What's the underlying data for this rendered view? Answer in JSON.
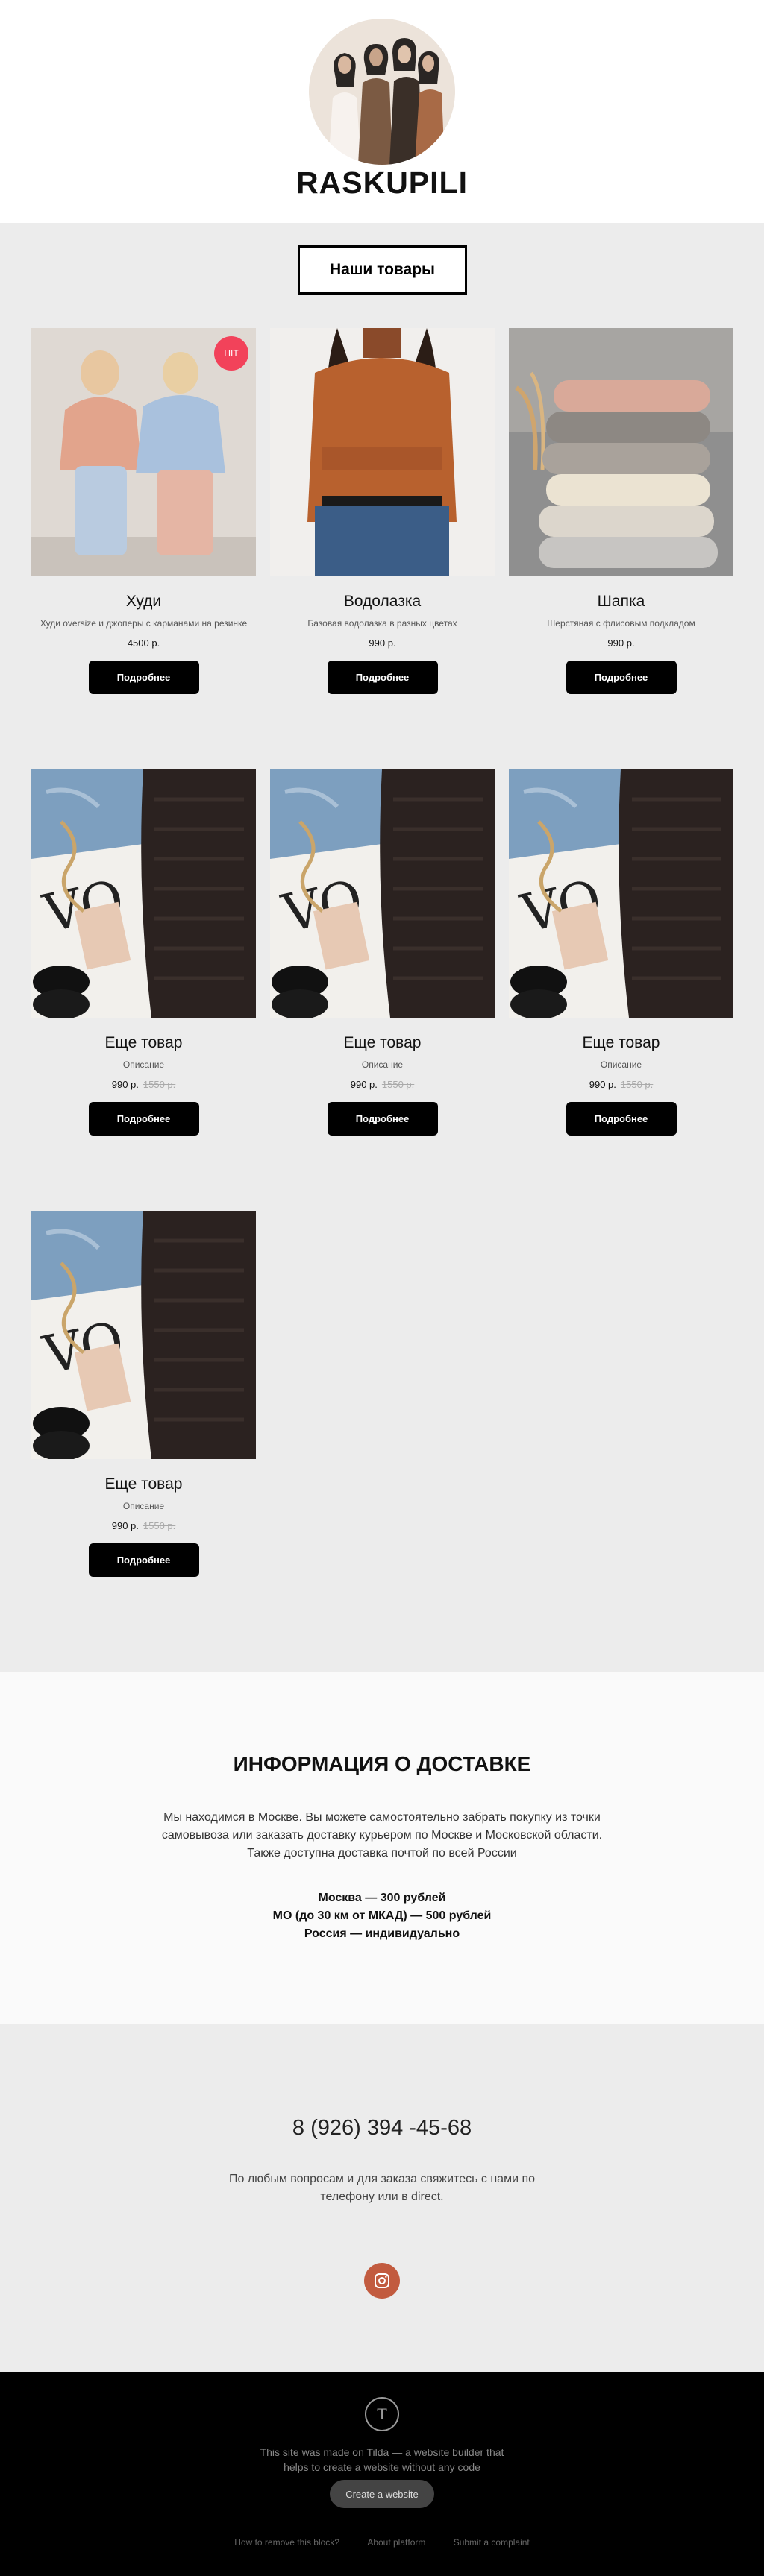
{
  "header": {
    "brand": "RASKUPILI"
  },
  "products_section": {
    "heading_button": "Наши товары",
    "items": [
      {
        "title": "Худи",
        "desc": "Худи oversize и джоперы с карманами на резинке",
        "price": "4500 р.",
        "old_price": "",
        "badge": "HIT",
        "button": "Подробнее"
      },
      {
        "title": "Водолазка",
        "desc": "Базовая водолазка в разных цветах",
        "price": "990 р.",
        "old_price": "",
        "badge": "",
        "button": "Подробнее"
      },
      {
        "title": "Шапка",
        "desc": "Шерстяная с флисовым подкладом",
        "price": "990 р.",
        "old_price": "",
        "badge": "",
        "button": "Подробнее"
      },
      {
        "title": "Еще товар",
        "desc": "Описание",
        "price": "990 р.",
        "old_price": "1550 р.",
        "badge": "",
        "button": "Подробнее"
      },
      {
        "title": "Еще товар",
        "desc": "Описание",
        "price": "990 р.",
        "old_price": "1550 р.",
        "badge": "",
        "button": "Подробнее"
      },
      {
        "title": "Еще товар",
        "desc": "Описание",
        "price": "990 р.",
        "old_price": "1550 р.",
        "badge": "",
        "button": "Подробнее"
      },
      {
        "title": "Еще товар",
        "desc": "Описание",
        "price": "990 р.",
        "old_price": "1550 р.",
        "badge": "",
        "button": "Подробнее"
      }
    ]
  },
  "delivery": {
    "title": "ИНФОРМАЦИЯ О ДОСТАВКЕ",
    "text_lines": [
      "Мы находимся в Москве. Вы можете самостоятельно забрать покупку из точки",
      "самовывоза или заказать доставку курьером по Москве и Московской области.",
      "Также доступна доставка почтой по всей России"
    ],
    "rates": [
      "Москва — 300 рублей",
      "МО (до 30 км от МКАД) — 500 рублей",
      "Россия — индивидуально"
    ]
  },
  "contacts": {
    "phone": "8 (926) 394 -45-68",
    "note_lines": [
      "По любым вопросам и для заказа свяжитесь с нами по",
      "телефону или в direct."
    ],
    "instagram_icon": "instagram-icon",
    "accent_color": "#c25b3f"
  },
  "footer": {
    "logo_letter": "T",
    "made_lines": [
      "This site was made on Tilda — a website builder that",
      "helps to create a website without any code"
    ],
    "create_button": "Create a website",
    "links": [
      "How to remove this block?",
      "About platform",
      "Submit a complaint"
    ]
  },
  "colors": {
    "badge": "#f2425a",
    "section_bg": "#ececec",
    "button_bg": "#000000"
  }
}
